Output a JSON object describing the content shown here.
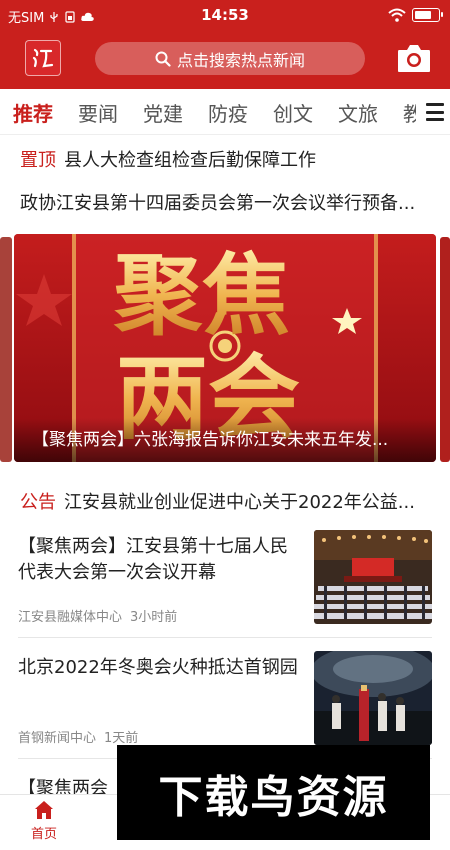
{
  "status_bar": {
    "carrier": "无SIM",
    "time": "14:53"
  },
  "app_bar": {
    "logo_text": "江",
    "search_placeholder": "点击搜索热点新闻"
  },
  "tabs": [
    {
      "label": "推荐",
      "active": true
    },
    {
      "label": "要闻",
      "active": false
    },
    {
      "label": "党建",
      "active": false
    },
    {
      "label": "防疫",
      "active": false
    },
    {
      "label": "创文",
      "active": false
    },
    {
      "label": "文旅",
      "active": false
    },
    {
      "label": "教",
      "active": false
    }
  ],
  "pinned": {
    "tag": "置顶",
    "title": "县人大检查组检查后勤保障工作"
  },
  "headline2": {
    "title": "政协江安县第十四届委员会第一次会议举行预备..."
  },
  "banner": {
    "art_text_1": "聚焦",
    "art_text_2": "两会",
    "caption": "【聚焦两会】六张海报告诉你江安未来五年发..."
  },
  "notice": {
    "tag": "公告",
    "title": "江安县就业创业促进中心关于2022年公益..."
  },
  "news": [
    {
      "title": "【聚焦两会】江安县第十七届人民代表大会第一次会议开幕",
      "source": "江安县融媒体中心",
      "time": "3小时前"
    },
    {
      "title": "北京2022年冬奥会火种抵达首钢园",
      "source": "首钢新闻中心",
      "time": "1天前"
    },
    {
      "title": "【聚焦两会"
    }
  ],
  "bottom_nav": [
    {
      "label": "首页",
      "active": true,
      "icon": "home-icon"
    }
  ],
  "watermark": "下载鸟资源",
  "colors": {
    "brand_red": "#c9201d",
    "text": "#222222",
    "muted": "#888888"
  }
}
